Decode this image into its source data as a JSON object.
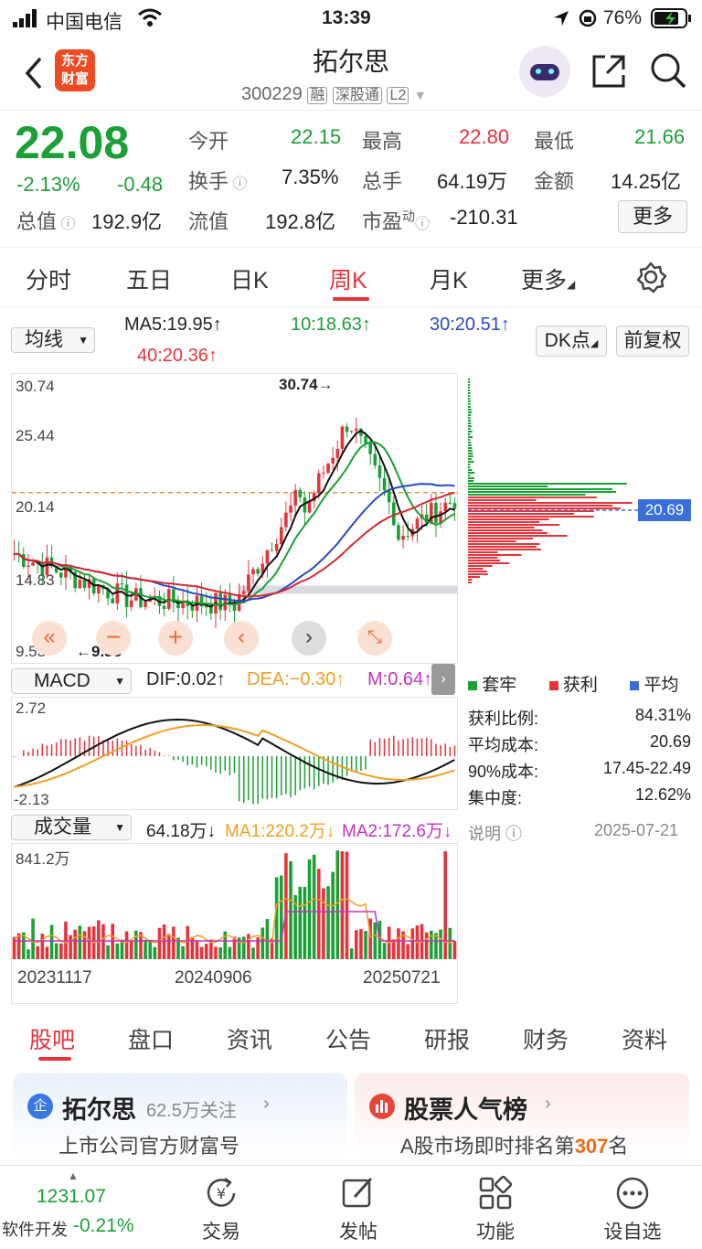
{
  "status": {
    "carrier": "中国电信",
    "time": "13:39",
    "battery": "76%"
  },
  "nav": {
    "logo_top": "东方",
    "logo_bottom": "财富",
    "title": "拓尔思",
    "code": "300229",
    "tag1": "融",
    "tag2": "深股通",
    "tag3": "L2"
  },
  "quote": {
    "price": "22.08",
    "pct": "-2.13%",
    "chg": "-0.48",
    "rows": [
      [
        {
          "label": "今开",
          "value": "22.15"
        },
        {
          "label": "最高",
          "value": "22.80"
        },
        {
          "label": "最低",
          "value": "21.66"
        }
      ],
      [
        {
          "label": "换手",
          "value": "7.35%"
        },
        {
          "label": "总手",
          "value": "64.19万"
        },
        {
          "label": "金额",
          "value": "14.25亿"
        }
      ]
    ],
    "total_label": "总值",
    "total_value": "192.9亿",
    "float_label": "流值",
    "float_value": "192.8亿",
    "pe_label": "市盈",
    "pe_sup": "动",
    "pe_value": "-210.31",
    "more": "更多"
  },
  "tabs": [
    "分时",
    "五日",
    "日K",
    "周K",
    "月K",
    "更多"
  ],
  "ma_bar": {
    "selector": "均线",
    "ma5": "MA5:19.95↑",
    "ma10": "10:18.63↑",
    "ma30": "30:20.51↑",
    "ma40": "40:20.36↑",
    "dk": "DK点",
    "fq": "前复权"
  },
  "kline": {
    "high_label": "30.74",
    "low_label": "9.53",
    "y_ticks": [
      "30.74",
      "25.44",
      "20.14",
      "14.83",
      "9.53"
    ],
    "high_marker": "30.74",
    "low_marker": "←9.53"
  },
  "macd": {
    "selector": "MACD",
    "dif": "DIF:0.02↑",
    "dea": "DEA:−0.30↑",
    "m": "M:0.64↑",
    "top": "2.72",
    "bottom": "-2.13"
  },
  "volume": {
    "selector": "成交量",
    "vol": "64.18万↓",
    "ma1": "MA1:220.2万↓",
    "ma2": "MA2:172.6万↓",
    "top": "841.2万",
    "dates": [
      "20231117",
      "20240906",
      "20250721"
    ]
  },
  "chip": {
    "legend": [
      "套牢",
      "获利",
      "平均"
    ],
    "price_tag": "20.69",
    "stats": [
      {
        "label": "获利比例:",
        "value": "84.31%"
      },
      {
        "label": "平均成本:",
        "value": "20.69"
      },
      {
        "label": "90%成本:",
        "value": "17.45-22.49"
      },
      {
        "label": "集中度:",
        "value": "12.62%"
      }
    ],
    "note": "说明",
    "date": "2025-07-21"
  },
  "bottom_tabs": [
    "股吧",
    "盘口",
    "资讯",
    "公告",
    "研报",
    "财务",
    "资料"
  ],
  "cards": {
    "left_title": "拓尔思",
    "left_sub": "62.5万关注",
    "left_desc": "上市公司官方财富号",
    "right_title": "股票人气榜",
    "right_desc_a": "A股市场即时排名第",
    "right_rank": "307",
    "right_desc_b": "名"
  },
  "footer": {
    "index_value": "1231.07",
    "index_name": "软件开发",
    "index_pct": "-0.21%",
    "items": [
      "交易",
      "发帖",
      "功能",
      "设自选"
    ]
  },
  "colors": {
    "red": "#e8323a",
    "green": "#1aa035",
    "accent": "#e8323a"
  }
}
